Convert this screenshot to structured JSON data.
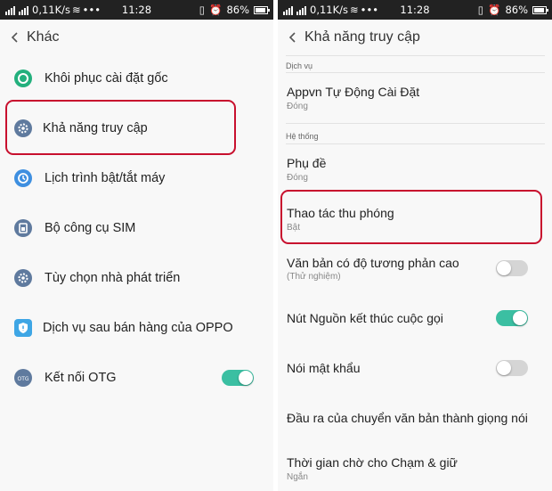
{
  "status_bar": {
    "speed": "0,11K/s",
    "dots": "•••",
    "time": "11:28",
    "battery": "86%"
  },
  "left_screen": {
    "title": "Khác",
    "items": [
      {
        "label": "Khôi phục cài đặt gốc",
        "icon": "restore-icon",
        "color": "#23b07d"
      },
      {
        "label": "Khả năng truy cập",
        "icon": "gear-icon",
        "color": "#5f7a9e"
      },
      {
        "label": "Lịch trình bật/tắt máy",
        "icon": "power-schedule-icon",
        "color": "#3e8fe0"
      },
      {
        "label": "Bộ công cụ SIM",
        "icon": "sim-icon",
        "color": "#5f7a9e"
      },
      {
        "label": "Tùy chọn nhà phát triển",
        "icon": "developer-gear-icon",
        "color": "#5f7a9e"
      },
      {
        "label": "Dịch vụ sau bán hàng của OPPO",
        "icon": "shield-icon",
        "color": "#3ea6e5"
      },
      {
        "label": "Kết nối OTG",
        "icon": "otg-icon",
        "color": "#5f7a9e",
        "toggle": true
      }
    ]
  },
  "right_screen": {
    "title": "Khả năng truy cập",
    "section_services": "Dịch vụ",
    "section_system": "Hệ thống",
    "items": [
      {
        "title": "Appvn Tự Động Cài Đặt",
        "sub": "Đóng"
      },
      {
        "title": "Phụ đề",
        "sub": "Đóng"
      },
      {
        "title": "Thao tác thu phóng",
        "sub": "Bật"
      },
      {
        "title": "Văn bản có độ tương phản cao",
        "sub": "(Thử nghiệm)",
        "toggle": false
      },
      {
        "title": "Nút Nguồn kết thúc cuộc gọi",
        "toggle": true
      },
      {
        "title": "Nói mật khẩu",
        "toggle": false
      },
      {
        "title": "Đầu ra của chuyển văn bản thành giọng nói"
      },
      {
        "title": "Thời gian chờ cho Chạm & giữ",
        "sub": "Ngắn"
      }
    ]
  },
  "colors": {
    "accent": "#3bbfa2",
    "highlight": "#c8102e"
  }
}
